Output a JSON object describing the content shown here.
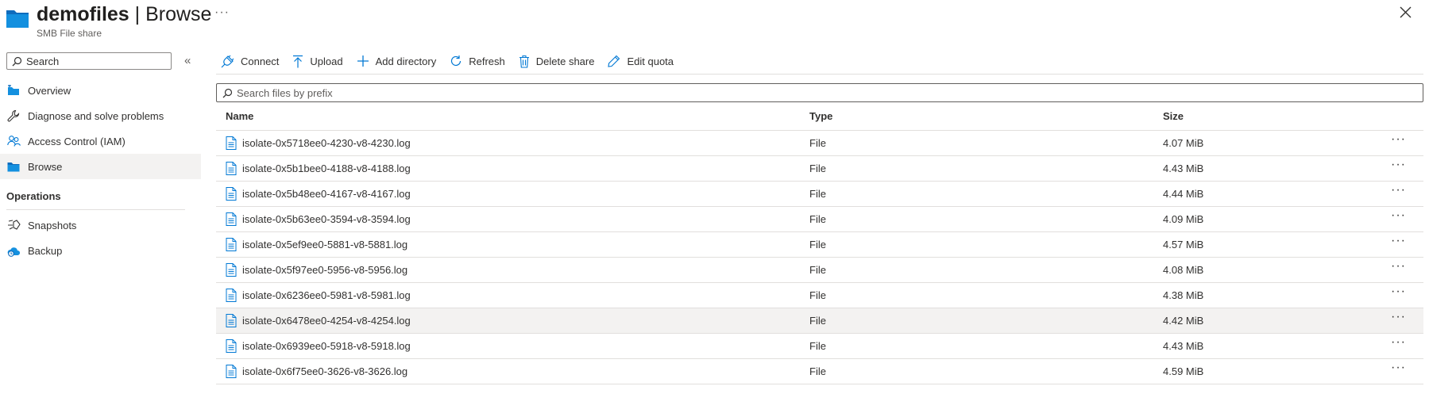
{
  "header": {
    "title_strong": "demofiles",
    "title_rest": " | Browse",
    "subtitle": "SMB File share",
    "more_label": "···"
  },
  "sidebar": {
    "search_placeholder": "Search",
    "collapse_label": "«",
    "items": [
      {
        "label": "Overview",
        "icon": "share-overview-icon"
      },
      {
        "label": "Diagnose and solve problems",
        "icon": "wrench-icon"
      },
      {
        "label": "Access Control (IAM)",
        "icon": "people-icon"
      },
      {
        "label": "Browse",
        "icon": "folder-icon"
      }
    ],
    "section_label": "Operations",
    "ops_items": [
      {
        "label": "Snapshots",
        "icon": "snapshot-icon"
      },
      {
        "label": "Backup",
        "icon": "cloud-backup-icon"
      }
    ]
  },
  "toolbar": {
    "connect": "Connect",
    "upload": "Upload",
    "add_directory": "Add directory",
    "refresh": "Refresh",
    "delete_share": "Delete share",
    "edit_quota": "Edit quota"
  },
  "file_search": {
    "placeholder": "Search files by prefix"
  },
  "table": {
    "columns": {
      "name": "Name",
      "type": "Type",
      "size": "Size"
    },
    "row_more": "···",
    "rows": [
      {
        "name": "isolate-0x5718ee0-4230-v8-4230.log",
        "type": "File",
        "size": "4.07 MiB"
      },
      {
        "name": "isolate-0x5b1bee0-4188-v8-4188.log",
        "type": "File",
        "size": "4.43 MiB"
      },
      {
        "name": "isolate-0x5b48ee0-4167-v8-4167.log",
        "type": "File",
        "size": "4.44 MiB"
      },
      {
        "name": "isolate-0x5b63ee0-3594-v8-3594.log",
        "type": "File",
        "size": "4.09 MiB"
      },
      {
        "name": "isolate-0x5ef9ee0-5881-v8-5881.log",
        "type": "File",
        "size": "4.57 MiB"
      },
      {
        "name": "isolate-0x5f97ee0-5956-v8-5956.log",
        "type": "File",
        "size": "4.08 MiB"
      },
      {
        "name": "isolate-0x6236ee0-5981-v8-5981.log",
        "type": "File",
        "size": "4.38 MiB"
      },
      {
        "name": "isolate-0x6478ee0-4254-v8-4254.log",
        "type": "File",
        "size": "4.42 MiB",
        "highlighted": true
      },
      {
        "name": "isolate-0x6939ee0-5918-v8-5918.log",
        "type": "File",
        "size": "4.43 MiB"
      },
      {
        "name": "isolate-0x6f75ee0-3626-v8-3626.log",
        "type": "File",
        "size": "4.59 MiB"
      }
    ]
  },
  "colors": {
    "accent": "#0078d4",
    "row_highlight": "#f3f2f1",
    "folder": "#1490df"
  }
}
